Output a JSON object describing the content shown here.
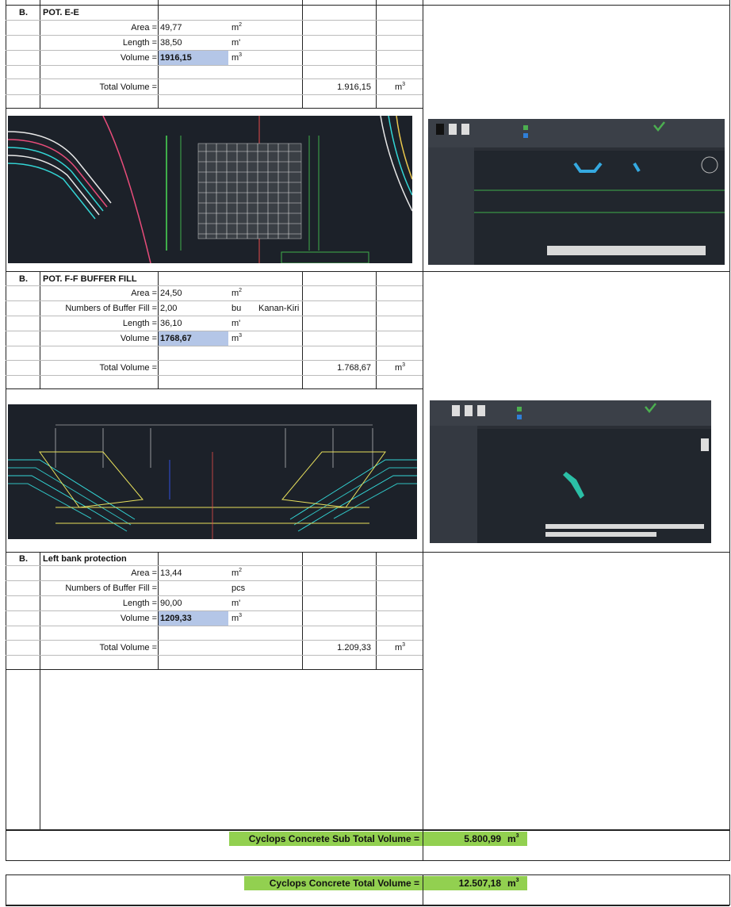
{
  "sections": [
    {
      "letter": "B.",
      "title": "POT. E-E",
      "rows": [
        {
          "label": "Area =",
          "value": "49,77",
          "unit": "m",
          "sup": "2"
        },
        {
          "label": "Length =",
          "value": "38,50",
          "unit": "m'",
          "sup": ""
        },
        {
          "label": "Volume =",
          "value": "1916,15",
          "unit": "m",
          "sup": "3"
        }
      ],
      "total_label": "Total Volume =",
      "total_value": "1.916,15",
      "total_unit": "m",
      "total_sup": "3"
    },
    {
      "letter": "B.",
      "title": "POT. F-F BUFFER FILL",
      "rows": [
        {
          "label": "Area =",
          "value": "24,50",
          "unit": "m",
          "sup": "2"
        },
        {
          "label": "Numbers of Buffer Fill =",
          "value": "2,00",
          "unit": "bu",
          "sup": "",
          "extra": "Kanan-Kiri"
        },
        {
          "label": "Length =",
          "value": "36,10",
          "unit": "m'",
          "sup": ""
        },
        {
          "label": "Volume =",
          "value": "1768,67",
          "unit": "m",
          "sup": "3"
        }
      ],
      "total_label": "Total Volume =",
      "total_value": "1.768,67",
      "total_unit": "m",
      "total_sup": "3"
    },
    {
      "letter": "B.",
      "title": "Left bank protection",
      "rows": [
        {
          "label": "Area =",
          "value": "13,44",
          "unit": "m",
          "sup": "2"
        },
        {
          "label": "Numbers of Buffer Fill =",
          "value": "",
          "unit": "pcs",
          "sup": ""
        },
        {
          "label": "Length =",
          "value": "90,00",
          "unit": "m'",
          "sup": ""
        },
        {
          "label": "Volume =",
          "value": "1209,33",
          "unit": "m",
          "sup": "3"
        }
      ],
      "total_label": "Total Volume =",
      "total_value": "1.209,33",
      "total_unit": "m",
      "total_sup": "3"
    }
  ],
  "subtotal": {
    "label": "Cyclops Concrete Sub Total Volume =",
    "value": "5.800,99",
    "unit": "m",
    "sup": "3"
  },
  "grandtotal": {
    "label": "Cyclops Concrete Total Volume =",
    "value": "12.507,18",
    "unit": "m",
    "sup": "3"
  },
  "colors": {
    "volume_highlight": "#b4c6e7",
    "total_highlight": "#92d050",
    "cad_bg": "#1c2129"
  }
}
